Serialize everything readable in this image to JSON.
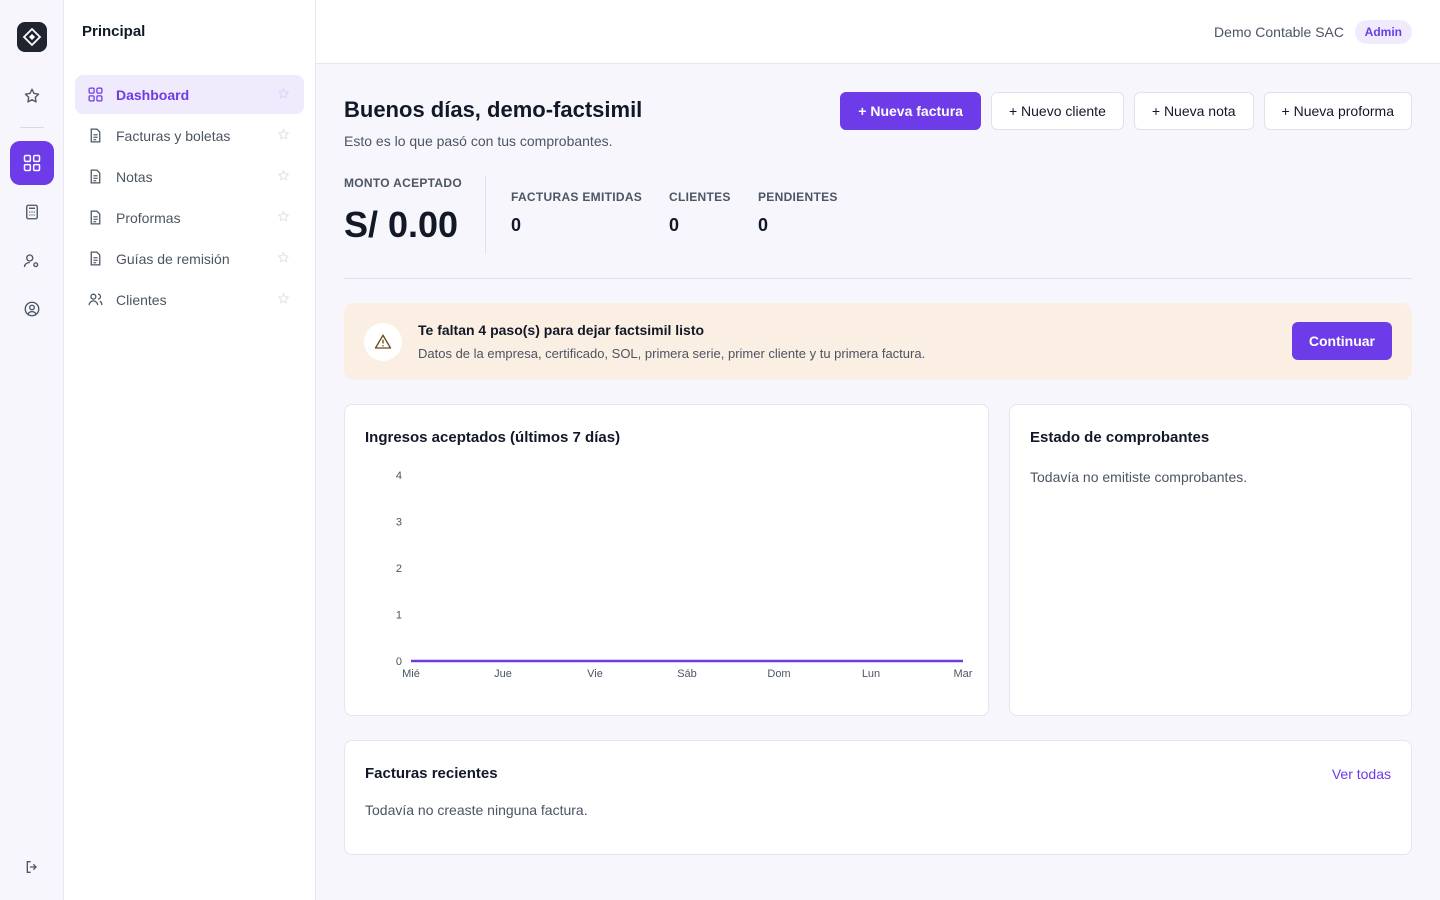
{
  "rail": {
    "icons": [
      "star-icon",
      "dashboard-icon",
      "calculator-icon",
      "user-settings-icon",
      "user-circle-icon",
      "logout-icon"
    ]
  },
  "sidebar": {
    "title": "Principal",
    "items": [
      {
        "label": "Dashboard",
        "icon": "dashboard-icon",
        "active": true
      },
      {
        "label": "Facturas y boletas",
        "icon": "document-icon"
      },
      {
        "label": "Notas",
        "icon": "document-icon"
      },
      {
        "label": "Proformas",
        "icon": "document-icon"
      },
      {
        "label": "Guías de remisión",
        "icon": "document-icon"
      },
      {
        "label": "Clientes",
        "icon": "users-icon"
      }
    ]
  },
  "header": {
    "company": "Demo Contable SAC",
    "role": "Admin"
  },
  "main": {
    "greeting": "Buenos días, demo-factsimil",
    "subtitle": "Esto es lo que pasó con tus comprobantes.",
    "actions": [
      "+ Nueva factura",
      "+ Nuevo cliente",
      "+ Nueva nota",
      "+ Nueva proforma"
    ]
  },
  "kpis": {
    "amount_label": "MONTO ACEPTADO",
    "amount_value": "S/ 0.00",
    "invoices_label": "FACTURAS EMITIDAS",
    "invoices_value": "0",
    "clients_label": "CLIENTES",
    "clients_value": "0",
    "pending_label": "PENDIENTES",
    "pending_value": "0"
  },
  "alert": {
    "title": "Te faltan 4 paso(s) para dejar factsimil listo",
    "text": "Datos de la empresa, certificado, SOL, primera serie, primer cliente y tu primera factura.",
    "button": "Continuar"
  },
  "income_card": {
    "title": "Ingresos aceptados (últimos 7 días)"
  },
  "status_card": {
    "title": "Estado de comprobantes",
    "empty": "Todavía no emitiste comprobantes."
  },
  "recent_card": {
    "title": "Facturas recientes",
    "link": "Ver todas",
    "empty": "Todavía no creaste ninguna factura."
  },
  "colors": {
    "accent": "#6d3be8",
    "alert_bg": "#fbeee2"
  },
  "chart_data": {
    "type": "line",
    "x": [
      "Mié",
      "Jue",
      "Vie",
      "Sáb",
      "Dom",
      "Lun",
      "Mar"
    ],
    "series": [
      {
        "values": [
          0,
          0,
          0,
          0,
          0,
          0,
          0
        ]
      }
    ],
    "yticks": [
      "0",
      "1",
      "2",
      "3",
      "4"
    ],
    "ylim": [
      0,
      4
    ],
    "grid": false
  }
}
